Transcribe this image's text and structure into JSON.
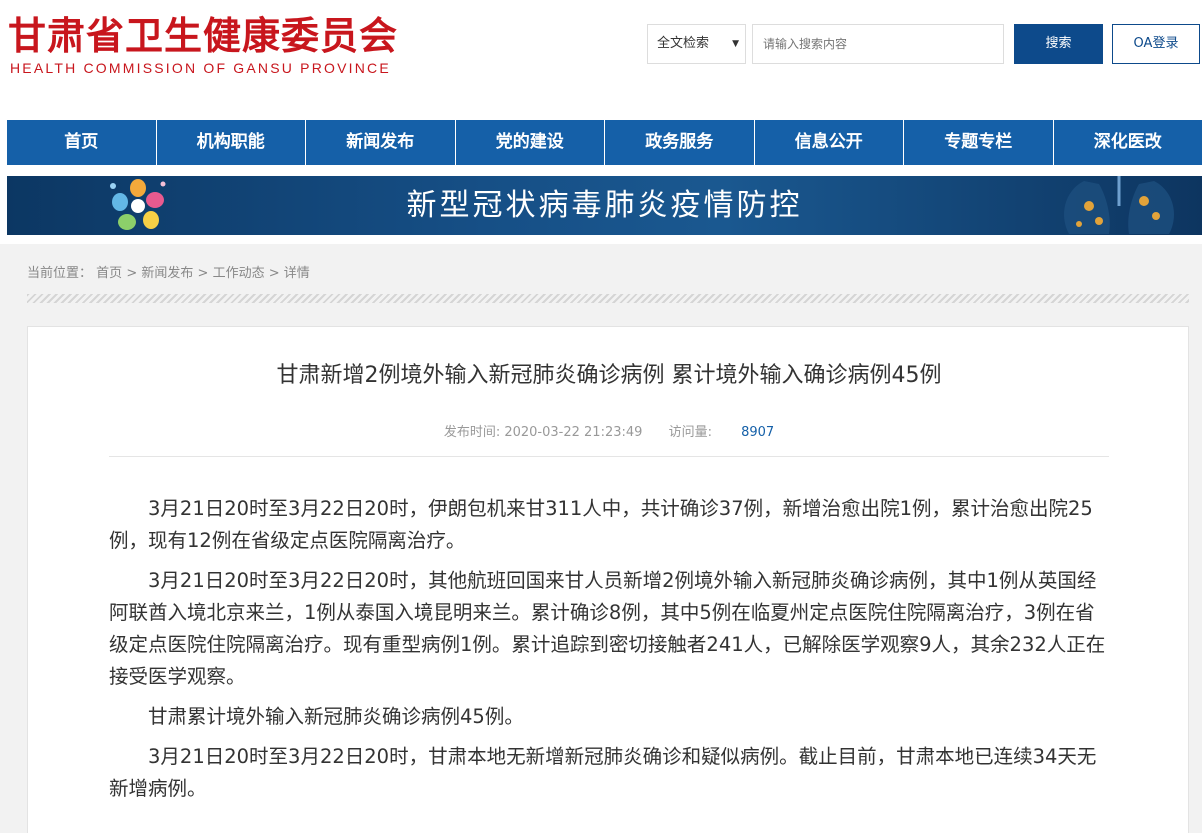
{
  "header": {
    "logo_cn": "甘肃省卫生健康委员会",
    "logo_en": "HEALTH COMMISSION OF GANSU PROVINCE"
  },
  "search": {
    "scope_selected": "全文检索",
    "placeholder": "请输入搜索内容",
    "button_label": "搜索",
    "oa_label": "OA登录"
  },
  "nav": {
    "items": [
      "首页",
      "机构职能",
      "新闻发布",
      "党的建设",
      "政务服务",
      "信息公开",
      "专题专栏",
      "深化医改"
    ]
  },
  "banner": {
    "text": "新型冠状病毒肺炎疫情防控"
  },
  "breadcrumb": {
    "prefix": "当前位置：",
    "items": [
      "首页",
      "新闻发布",
      "工作动态",
      "详情"
    ],
    "separator": ">"
  },
  "article": {
    "title": "甘肃新增2例境外输入新冠肺炎确诊病例 累计境外输入确诊病例45例",
    "publish_label": "发布时间:",
    "publish_time": "2020-03-22 21:23:49",
    "views_label": "访问量:",
    "views_count": "8907",
    "paragraphs": [
      "3月21日20时至3月22日20时，伊朗包机来甘311人中，共计确诊37例，新增治愈出院1例，累计治愈出院25例，现有12例在省级定点医院隔离治疗。",
      "3月21日20时至3月22日20时，其他航班回国来甘人员新增2例境外输入新冠肺炎确诊病例，其中1例从英国经阿联酋入境北京来兰，1例从泰国入境昆明来兰。累计确诊8例，其中5例在临夏州定点医院住院隔离治疗，3例在省级定点医院住院隔离治疗。现有重型病例1例。累计追踪到密切接触者241人，已解除医学观察9人，其余232人正在接受医学观察。",
      "甘肃累计境外输入新冠肺炎确诊病例45例。",
      "3月21日20时至3月22日20时，甘肃本地无新增新冠肺炎确诊和疑似病例。截止目前，甘肃本地已连续34天无新增病例。"
    ]
  },
  "colors": {
    "brand_red": "#c8161d",
    "nav_blue": "#1560a8",
    "button_blue": "#0d4a8b"
  },
  "icons": {
    "banner_left": "flower-petals-icon",
    "banner_right": "lungs-virus-icon",
    "select_arrow": "triangle-down-icon"
  }
}
